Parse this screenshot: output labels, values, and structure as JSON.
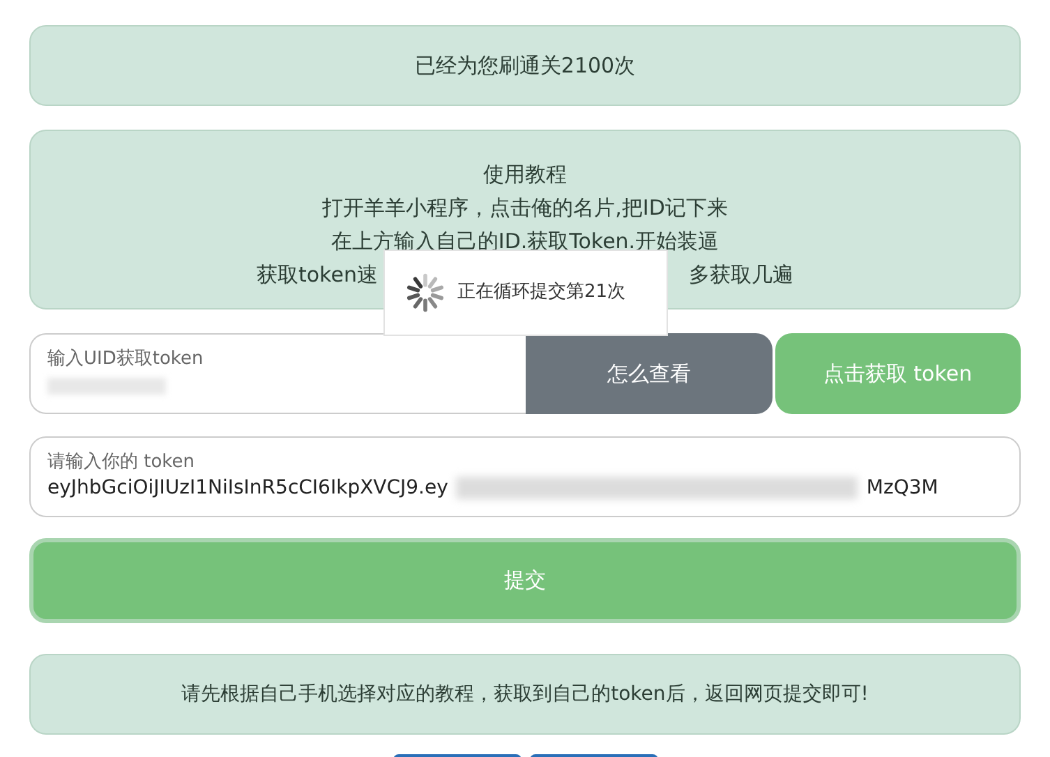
{
  "banner": "已经为您刷通关2100次",
  "tutorial": {
    "lines": [
      "使用教程",
      "打开羊羊小程序，点击俺的名片,把ID记下来",
      "在上方输入自己的ID.获取Token.开始装逼"
    ],
    "last_line_left": "获取token速",
    "last_line_right": "多获取几遍"
  },
  "toast": {
    "text": "正在循环提交第21次"
  },
  "uid_field": {
    "label": "输入UID获取token"
  },
  "buttons": {
    "how_to": "怎么查看",
    "get_token": "点击获取 token",
    "submit": "提交"
  },
  "token_field": {
    "label": "请输入你的 token",
    "value_start": "eyJhbGciOiJIUzI1NiIsInR5cCI6IkpXVCJ9.ey",
    "value_end": "MzQ3M"
  },
  "notice": "请先根据自己手机选择对应的教程，获取到自己的token后，返回网页提交即可!"
}
